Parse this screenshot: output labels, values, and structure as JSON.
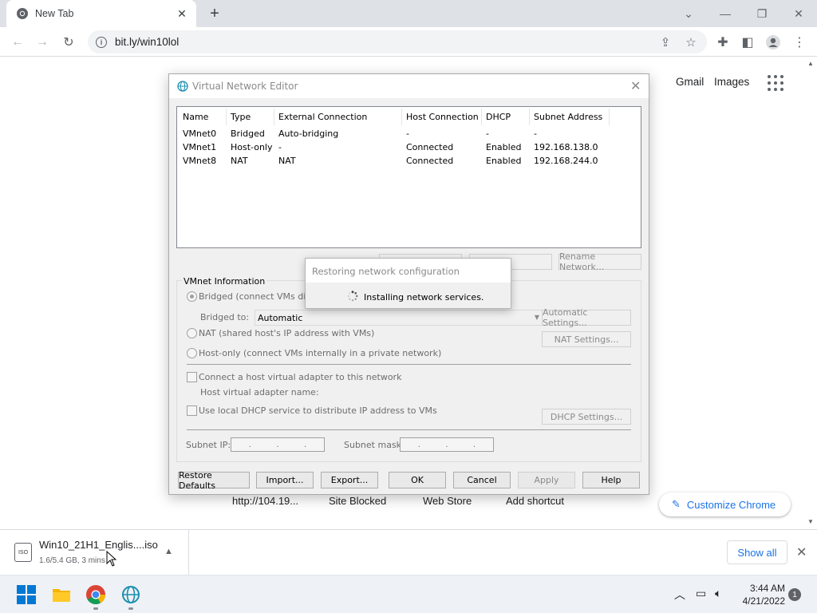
{
  "browser": {
    "tab_title": "New Tab",
    "url": "bit.ly/win10lol",
    "ntp_links": {
      "gmail": "Gmail",
      "images": "Images"
    },
    "shortcuts": [
      "http://104.19...",
      "Site Blocked",
      "Web Store",
      "Add shortcut"
    ],
    "customize_label": "Customize Chrome"
  },
  "dialog": {
    "title": "Virtual Network Editor",
    "columns": [
      "Name",
      "Type",
      "External Connection",
      "Host Connection",
      "DHCP",
      "Subnet Address"
    ],
    "rows": [
      [
        "VMnet0",
        "Bridged",
        "Auto-bridging",
        "-",
        "-",
        "-"
      ],
      [
        "VMnet1",
        "Host-only",
        "-",
        "Connected",
        "Enabled",
        "192.168.138.0"
      ],
      [
        "VMnet8",
        "NAT",
        "NAT",
        "Connected",
        "Enabled",
        "192.168.244.0"
      ]
    ],
    "top_buttons": {
      "rename": "Rename Network..."
    },
    "vmnet_info": {
      "group_label": "VMnet Information",
      "bridged_label": "Bridged (connect VMs directly to the external network)",
      "bridged_to_label": "Bridged to:",
      "bridged_to_value": "Automatic",
      "auto_settings": "Automatic Settings...",
      "nat_label": "NAT (shared host's IP address with VMs)",
      "nat_settings": "NAT Settings...",
      "hostonly_label": "Host-only (connect VMs internally in a private network)",
      "connect_adapter_label": "Connect a host virtual adapter to this network",
      "adapter_name_label": "Host virtual adapter name:",
      "dhcp_label": "Use local DHCP service to distribute IP address to VMs",
      "dhcp_settings": "DHCP Settings...",
      "subnet_ip_label": "Subnet IP:",
      "subnet_mask_label": "Subnet mask:"
    },
    "bottom_buttons": {
      "restore": "Restore Defaults",
      "import": "Import...",
      "export": "Export...",
      "ok": "OK",
      "cancel": "Cancel",
      "apply": "Apply",
      "help": "Help"
    }
  },
  "progress": {
    "title": "Restoring network configuration",
    "message": "Installing network services."
  },
  "download": {
    "filename": "Win10_21H1_Englis....iso",
    "status": "1.6/5.4 GB, 3 mins",
    "icon_text": "ISO",
    "show_all": "Show all"
  },
  "taskbar": {
    "time": "3:44 AM",
    "date": "4/21/2022",
    "notification_count": "1"
  }
}
